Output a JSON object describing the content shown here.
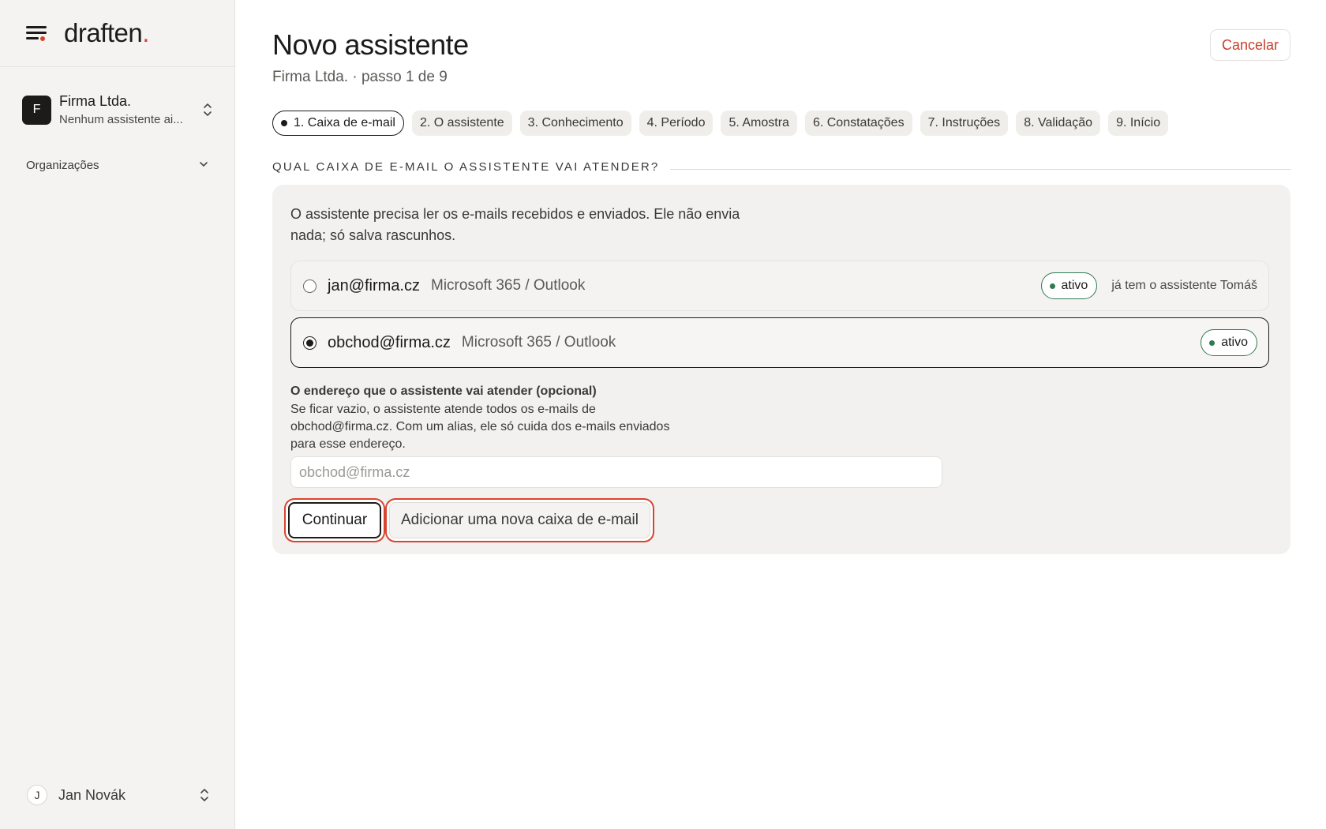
{
  "brand": {
    "logo_text": "draften",
    "logo_dot": ".",
    "accent_color": "#d9442f"
  },
  "sidebar": {
    "org": {
      "avatar_letter": "F",
      "name": "Firma Ltda.",
      "subtitle": "Nenhum assistente ai..."
    },
    "section_label": "Organizações",
    "user": {
      "avatar_letter": "J",
      "name": "Jan Novák"
    }
  },
  "header": {
    "title": "Novo assistente",
    "subtitle": "Firma Ltda. · passo 1 de 9",
    "cancel_label": "Cancelar"
  },
  "steps": [
    {
      "label": "1. Caixa de e-mail",
      "active": true
    },
    {
      "label": "2. O assistente",
      "active": false
    },
    {
      "label": "3. Conhecimento",
      "active": false
    },
    {
      "label": "4. Período",
      "active": false
    },
    {
      "label": "5. Amostra",
      "active": false
    },
    {
      "label": "6. Constatações",
      "active": false
    },
    {
      "label": "7. Instruções",
      "active": false
    },
    {
      "label": "8. Validação",
      "active": false
    },
    {
      "label": "9. Início",
      "active": false
    }
  ],
  "section": {
    "title": "QUAL CAIXA DE E-MAIL O ASSISTENTE VAI ATENDER?",
    "description": "O assistente precisa ler os e-mails recebidos e enviados. Ele não envia nada; só salva rascunhos."
  },
  "mailboxes": [
    {
      "address": "jan@firma.cz",
      "provider": "Microsoft 365 / Outlook",
      "status": "ativo",
      "note": "já tem o assistente Tomáš",
      "selected": false
    },
    {
      "address": "obchod@firma.cz",
      "provider": "Microsoft 365 / Outlook",
      "status": "ativo",
      "note": "",
      "selected": true
    }
  ],
  "alias_field": {
    "label": "O endereço que o assistente vai atender (opcional)",
    "help": "Se ficar vazio, o assistente atende todos os e-mails de obchod@firma.cz. Com um alias, ele só cuida dos e-mails enviados para esse endereço.",
    "placeholder": "obchod@firma.cz",
    "value": ""
  },
  "actions": {
    "continue_label": "Continuar",
    "add_mailbox_label": "Adicionar uma nova caixa de e-mail"
  },
  "colors": {
    "status_green": "#2f7a52",
    "cancel_red": "#c9402b",
    "highlight_red": "#d9442f"
  }
}
